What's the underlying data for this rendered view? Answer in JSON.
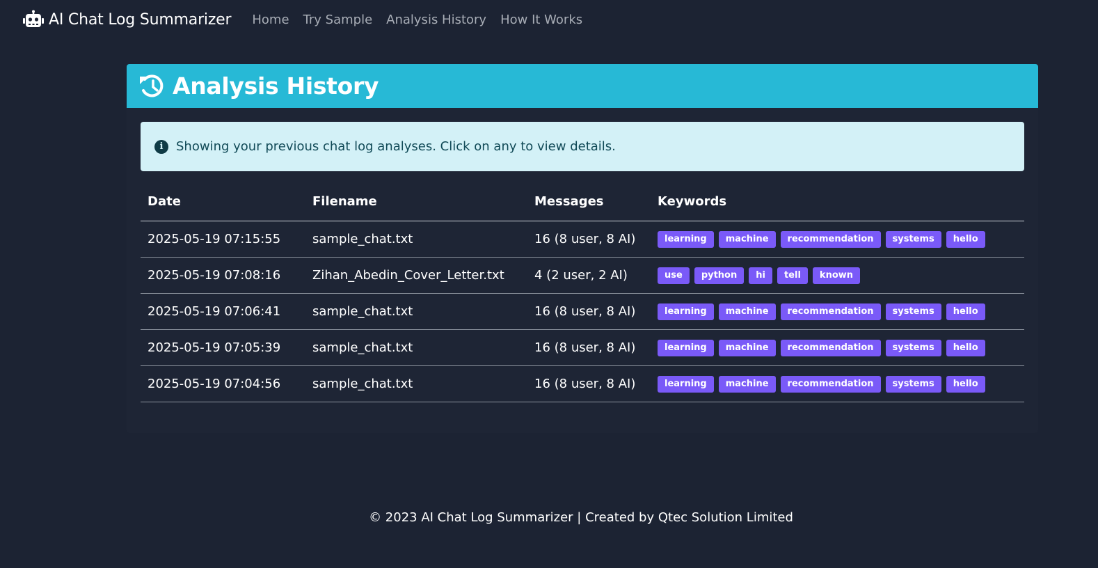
{
  "nav": {
    "brand": "AI Chat Log Summarizer",
    "brand_icon": "robot-icon",
    "links": [
      "Home",
      "Try Sample",
      "Analysis History",
      "How It Works"
    ]
  },
  "card": {
    "title": "Analysis History",
    "title_icon": "history-icon",
    "header_color": "#27b9d6"
  },
  "alert": {
    "icon": "info-icon",
    "text": "Showing your previous chat log analyses. Click on any to view details."
  },
  "table": {
    "headers": [
      "Date",
      "Filename",
      "Messages",
      "Keywords"
    ],
    "rows": [
      {
        "date": "2025-05-19 07:15:55",
        "filename": "sample_chat.txt",
        "messages": "16 (8 user, 8 AI)",
        "keywords": [
          "learning",
          "machine",
          "recommendation",
          "systems",
          "hello"
        ]
      },
      {
        "date": "2025-05-19 07:08:16",
        "filename": "Zihan_Abedin_Cover_Letter.txt",
        "messages": "4 (2 user, 2 AI)",
        "keywords": [
          "use",
          "python",
          "hi",
          "tell",
          "known"
        ]
      },
      {
        "date": "2025-05-19 07:06:41",
        "filename": "sample_chat.txt",
        "messages": "16 (8 user, 8 AI)",
        "keywords": [
          "learning",
          "machine",
          "recommendation",
          "systems",
          "hello"
        ]
      },
      {
        "date": "2025-05-19 07:05:39",
        "filename": "sample_chat.txt",
        "messages": "16 (8 user, 8 AI)",
        "keywords": [
          "learning",
          "machine",
          "recommendation",
          "systems",
          "hello"
        ]
      },
      {
        "date": "2025-05-19 07:04:56",
        "filename": "sample_chat.txt",
        "messages": "16 (8 user, 8 AI)",
        "keywords": [
          "learning",
          "machine",
          "recommendation",
          "systems",
          "hello"
        ]
      }
    ]
  },
  "footer": {
    "text": "© 2023 AI Chat Log Summarizer | Created by Qtec Solution Limited"
  },
  "colors": {
    "background": "#1c2333",
    "badge": "#7a5af8",
    "alert_bg": "#d3f1f7"
  }
}
